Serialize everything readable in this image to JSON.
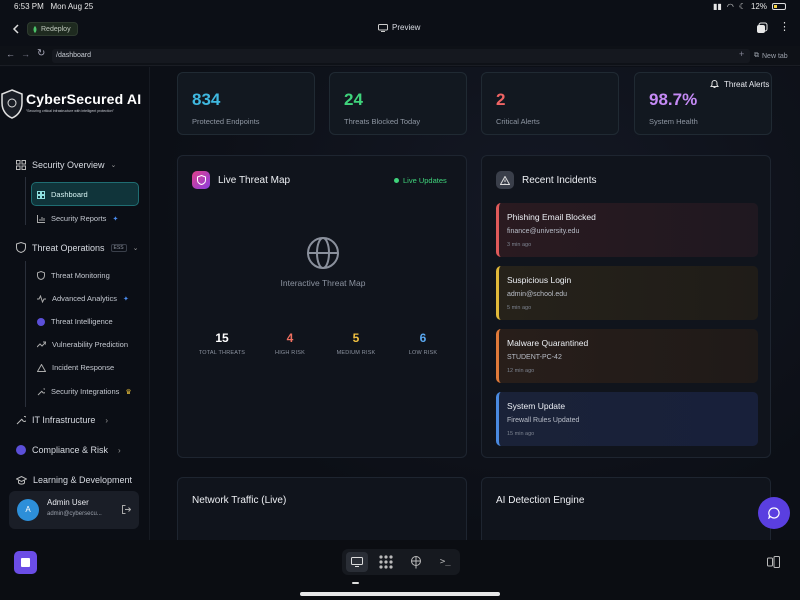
{
  "status": {
    "time": "6:53 PM",
    "date": "Mon Aug 25",
    "battery": "12%"
  },
  "app": {
    "deploy_label": "Redeploy",
    "preview_label": "Preview"
  },
  "browser": {
    "url": "/dashboard",
    "new_tab": "New tab"
  },
  "brand": {
    "name": "CyberSecured AI",
    "tagline": "Securing critical infrastructure with intelligent protection"
  },
  "sidebar": {
    "security_overview": "Security Overview",
    "dashboard": "Dashboard",
    "security_reports": "Security Reports",
    "threat_operations": "Threat Operations",
    "ess_badge": "ESS",
    "threat_monitoring": "Threat Monitoring",
    "advanced_analytics": "Advanced Analytics",
    "threat_intelligence": "Threat Intelligence",
    "vulnerability_prediction": "Vulnerability Prediction",
    "incident_response": "Incident Response",
    "security_integrations": "Security Integrations",
    "it_infrastructure": "IT Infrastructure",
    "compliance_risk": "Compliance & Risk",
    "learning_development": "Learning & Development"
  },
  "user": {
    "initial": "A",
    "name": "Admin User",
    "email": "admin@cybersecu..."
  },
  "header": {
    "threat_alerts": "Threat Alerts"
  },
  "stats": [
    {
      "value": "834",
      "label": "Protected Endpoints",
      "color": "#3fb8e0"
    },
    {
      "value": "24",
      "label": "Threats Blocked Today",
      "color": "#3fd37b"
    },
    {
      "value": "2",
      "label": "Critical Alerts",
      "color": "#f06464"
    },
    {
      "value": "98.7%",
      "label": "System Health",
      "color": "#c58af5"
    }
  ],
  "threat_map": {
    "title": "Live Threat Map",
    "live": "Live Updates",
    "placeholder": "Interactive Threat Map",
    "totals": [
      {
        "value": "15",
        "label": "TOTAL THREATS",
        "color": "#ffffff"
      },
      {
        "value": "4",
        "label": "HIGH RISK",
        "color": "#f07060"
      },
      {
        "value": "5",
        "label": "MEDIUM RISK",
        "color": "#f0c040"
      },
      {
        "value": "6",
        "label": "LOW RISK",
        "color": "#5aa8f0"
      }
    ]
  },
  "incidents": {
    "title": "Recent Incidents",
    "items": [
      {
        "title": "Phishing Email Blocked",
        "subtitle": "finance@university.edu",
        "time": "3 min ago",
        "color": "#e05a5a"
      },
      {
        "title": "Suspicious Login",
        "subtitle": "admin@school.edu",
        "time": "5 min ago",
        "color": "#e0b83a"
      },
      {
        "title": "Malware Quarantined",
        "subtitle": "STUDENT-PC-42",
        "time": "12 min ago",
        "color": "#e07a3a"
      },
      {
        "title": "System Update",
        "subtitle": "Firewall Rules Updated",
        "time": "15 min ago",
        "color": "#4a8ae0"
      }
    ]
  },
  "panels": {
    "network_traffic": "Network Traffic (Live)",
    "ai_engine": "AI Detection Engine"
  }
}
